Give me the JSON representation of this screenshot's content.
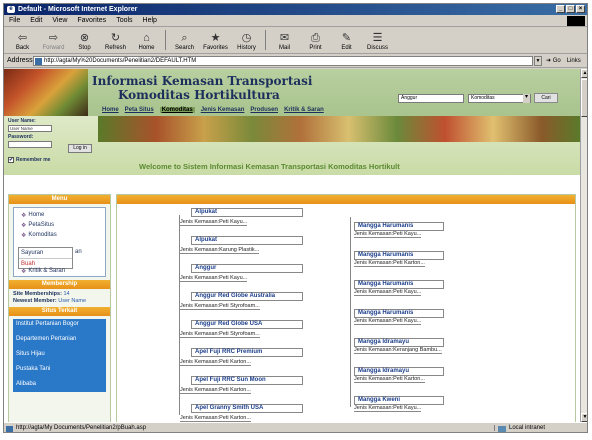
{
  "window": {
    "title": "Default - Microsoft Internet Explorer",
    "controls": [
      "_",
      "□",
      "×"
    ]
  },
  "menubar": [
    "File",
    "Edit",
    "View",
    "Favorites",
    "Tools",
    "Help"
  ],
  "toolbar": [
    {
      "label": "Back",
      "icon": "back-arrow-icon",
      "glyph": "⇦"
    },
    {
      "label": "Forward",
      "icon": "forward-arrow-icon",
      "glyph": "⇨"
    },
    {
      "label": "Stop",
      "icon": "stop-icon",
      "glyph": "⊗"
    },
    {
      "label": "Refresh",
      "icon": "refresh-icon",
      "glyph": "↻"
    },
    {
      "label": "Home",
      "icon": "home-icon",
      "glyph": "⌂"
    },
    {
      "label": "Search",
      "icon": "search-icon",
      "glyph": "⌕"
    },
    {
      "label": "Favorites",
      "icon": "favorites-icon",
      "glyph": "★"
    },
    {
      "label": "History",
      "icon": "history-icon",
      "glyph": "◷"
    },
    {
      "label": "Mail",
      "icon": "mail-icon",
      "glyph": "✉"
    },
    {
      "label": "Print",
      "icon": "print-icon",
      "glyph": "⎙"
    },
    {
      "label": "Edit",
      "icon": "edit-icon",
      "glyph": "✎"
    },
    {
      "label": "Discuss",
      "icon": "discuss-icon",
      "glyph": "☰"
    }
  ],
  "address": {
    "label": "Address",
    "url": "http://agta/My%20Documents/Penelitian2/DEFAULT.HTM",
    "go": "Go",
    "links": "Links"
  },
  "site": {
    "title_line1": "Informasi Kemasan Transportasi",
    "title_line2": "Komoditas Hortikultura",
    "nav": [
      "Home",
      "Peta Situs",
      "Komoditas",
      "Jenis Kemasan",
      "Produsen",
      "Kritik & Saran"
    ],
    "search_value": "Anggur",
    "search_category": "Komoditas",
    "search_button": "Cari",
    "welcome": "Welcome to Sistem Informasi Kemasan Transportasi Komoditas Hortikult"
  },
  "login": {
    "username_label": "User Name:",
    "username_value": "User Name",
    "password_label": "Password:",
    "login_button": "Log in",
    "remember_label": "Remember me",
    "remember_checked": "✔"
  },
  "sidebar": {
    "menu_header": "Menu",
    "menu_items": [
      "Home",
      "PetaSitus",
      "Komoditas"
    ],
    "submenu": [
      "Sayuran",
      "Buah"
    ],
    "submenu_tail": "an",
    "menu_last": "Kritik & Saran",
    "membership_header": "Membership",
    "site_memberships_label": "Site Memberships:",
    "site_memberships_value": "14",
    "newest_member_label": "Newest Member:",
    "newest_member_value": "User Name",
    "links_header": "Situs Terkait",
    "links": [
      "Institut Pertanian Bogor",
      "Departemen Pertanian",
      "Situs Hijau",
      "Pustaka Tani",
      "Alibaba"
    ]
  },
  "list": {
    "left": [
      {
        "name": "Alpukat",
        "desc": "Jenis Kemasan:Peti Kayu..."
      },
      {
        "name": "Alpukat",
        "desc": "Jenis Kemasan:Karung Plastik..."
      },
      {
        "name": "Anggur",
        "desc": "Jenis Kemasan:Peti Kayu..."
      },
      {
        "name": "Anggur Red Globe Australia",
        "desc": "Jenis Kemasan:Peti Styrofoam..."
      },
      {
        "name": "Anggur Red Globe USA",
        "desc": "Jenis Kemasan:Peti Styrofoam..."
      },
      {
        "name": "Apel Fuji RRC Premium",
        "desc": "Jenis Kemasan:Peti Karton..."
      },
      {
        "name": "Apel Fuji RRC Sun Moon",
        "desc": "Jenis Kemasan:Peti Karton..."
      },
      {
        "name": "Apel Granny Smith USA",
        "desc": "Jenis Kemasan:Peti Karton..."
      }
    ],
    "right": [
      {
        "name": "Mangga Harumanis",
        "desc": "Jenis Kemasan:Peti Kayu..."
      },
      {
        "name": "Mangga Harumanis",
        "desc": "Jenis Kemasan:Peti Karton..."
      },
      {
        "name": "Mangga Harumanis",
        "desc": "Jenis Kemasan:Peti Kayu..."
      },
      {
        "name": "Mangga Harumanis",
        "desc": "Jenis Kemasan:Peti Kayu..."
      },
      {
        "name": "Mangga Idramayu",
        "desc": "Jenis Kemasan:Keranjang Bambu..."
      },
      {
        "name": "Mangga Idramayu",
        "desc": "Jenis Kemasan:Peti Karton..."
      },
      {
        "name": "Mangga Kweni",
        "desc": "Jenis Kemasan:Peti Kayu..."
      }
    ]
  },
  "status": {
    "text": "http://agta/My Documents/Penelitian2/pBuah.asp",
    "zone": "Local intranet"
  }
}
